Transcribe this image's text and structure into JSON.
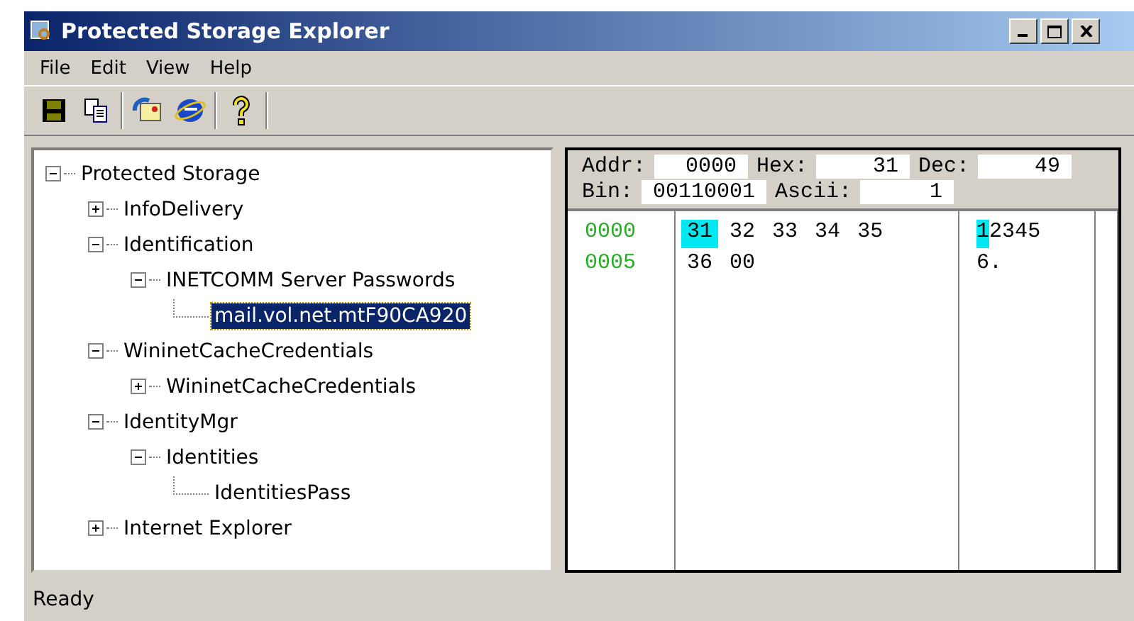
{
  "window": {
    "title": "Protected Storage Explorer"
  },
  "menu": [
    "File",
    "Edit",
    "View",
    "Help"
  ],
  "tree": [
    {
      "label": "Protected Storage",
      "expanded": true,
      "selected": false,
      "children": [
        {
          "label": "InfoDelivery",
          "expanded": false,
          "selected": false
        },
        {
          "label": "Identification",
          "expanded": true,
          "selected": false,
          "children": [
            {
              "label": "INETCOMM Server Passwords",
              "expanded": true,
              "selected": false,
              "children": [
                {
                  "label": "mail.vol.net.mtF90CA920",
                  "selected": true
                }
              ]
            }
          ]
        },
        {
          "label": "WininetCacheCredentials",
          "expanded": true,
          "selected": false,
          "children": [
            {
              "label": "WininetCacheCredentials",
              "expanded": false,
              "selected": false
            }
          ]
        },
        {
          "label": "IdentityMgr",
          "expanded": true,
          "selected": false,
          "children": [
            {
              "label": "Identities",
              "expanded": true,
              "selected": false,
              "children": [
                {
                  "label": "IdentitiesPass",
                  "selected": false
                }
              ]
            }
          ]
        },
        {
          "label": "Internet Explorer",
          "expanded": false,
          "selected": false
        }
      ]
    }
  ],
  "hex_header": [
    [
      {
        "label": "Addr:",
        "value": "0000"
      },
      {
        "label": "Hex:",
        "value": "31"
      },
      {
        "label": "Dec:",
        "value": "49"
      }
    ],
    [
      {
        "label": "Bin:",
        "value": "00110001"
      },
      {
        "label": "Ascii:",
        "value": "1"
      }
    ]
  ],
  "hex_rows": [
    {
      "address": "0000",
      "bytes": [
        {
          "text": "31",
          "selected": true
        },
        {
          "text": "32",
          "selected": false
        },
        {
          "text": "33",
          "selected": false
        },
        {
          "text": "34",
          "selected": false
        },
        {
          "text": "35",
          "selected": false
        }
      ],
      "ascii": [
        {
          "text": "1",
          "selected": true
        },
        {
          "text": "2",
          "selected": false
        },
        {
          "text": "3",
          "selected": false
        },
        {
          "text": "4",
          "selected": false
        },
        {
          "text": "5",
          "selected": false
        }
      ]
    },
    {
      "address": "0005",
      "bytes": [
        {
          "text": "36",
          "selected": false
        },
        {
          "text": "00",
          "selected": false
        }
      ],
      "ascii": [
        {
          "text": "6",
          "selected": false
        },
        {
          "text": ".",
          "selected": false
        }
      ]
    }
  ],
  "status_bar": "Ready"
}
